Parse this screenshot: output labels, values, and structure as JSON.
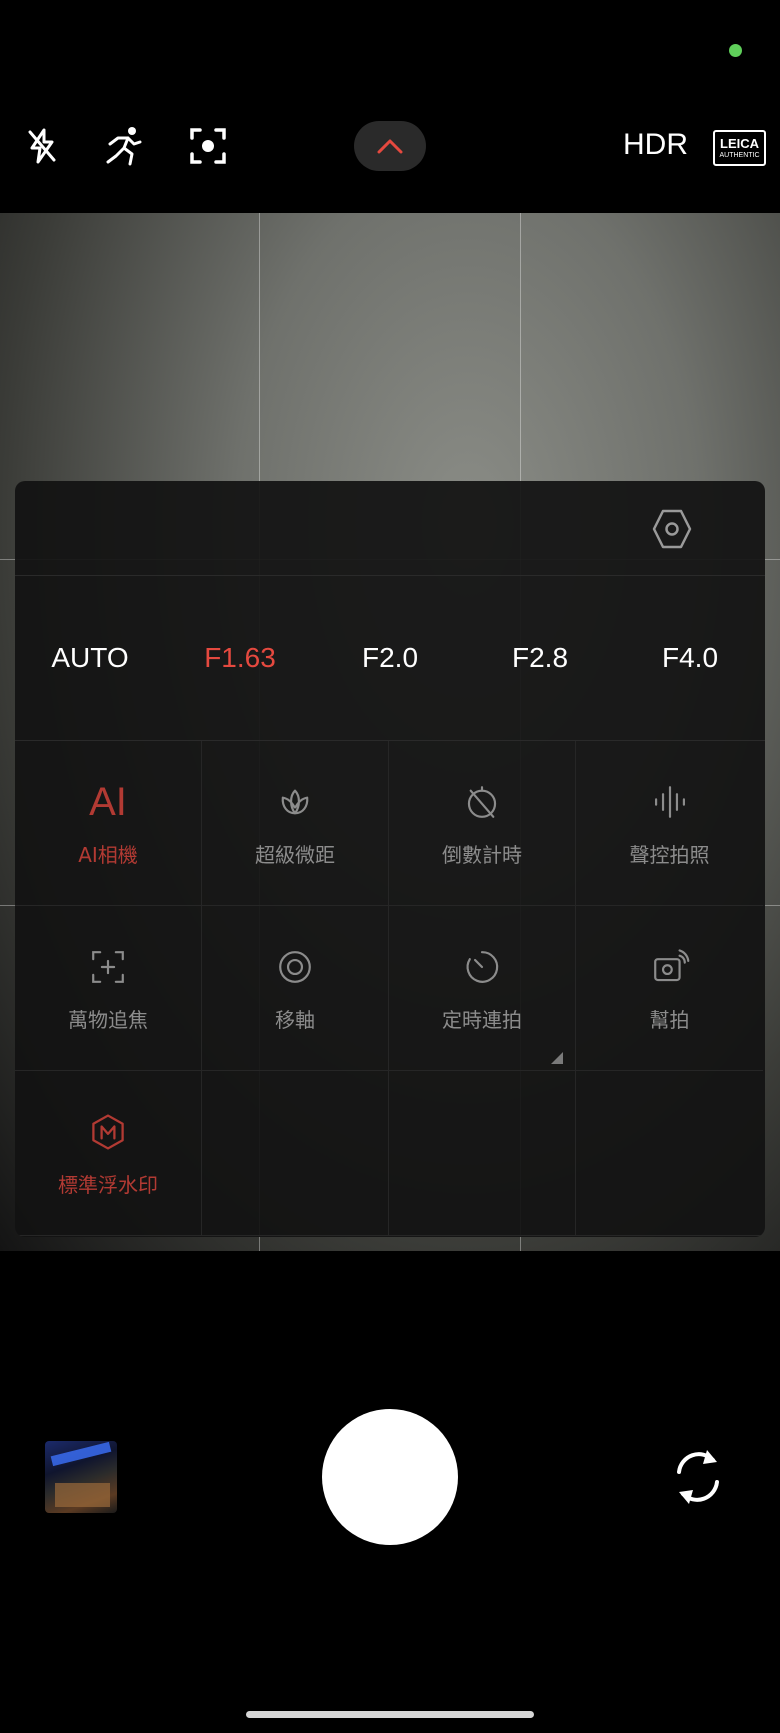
{
  "status": {
    "indicator_color": "#5fcf5a"
  },
  "top_bar": {
    "icons": [
      "flash-off-icon",
      "motion-icon",
      "focus-icon"
    ],
    "expand_icon": "chevron-up-icon",
    "hdr_label": "HDR",
    "leica": {
      "line1": "LEICA",
      "line2": "AUTHENTIC"
    }
  },
  "panel": {
    "settings_icon": "settings-icon",
    "apertures": [
      {
        "label": "AUTO",
        "active": false
      },
      {
        "label": "F1.63",
        "active": true
      },
      {
        "label": "F2.0",
        "active": false
      },
      {
        "label": "F2.8",
        "active": false
      },
      {
        "label": "F4.0",
        "active": false
      }
    ],
    "tiles": [
      {
        "label": "AI相機",
        "icon": "ai-icon",
        "glyph": "AI",
        "active": true
      },
      {
        "label": "超級微距",
        "icon": "macro-icon",
        "active": false
      },
      {
        "label": "倒數計時",
        "icon": "timer-off-icon",
        "active": false
      },
      {
        "label": "聲控拍照",
        "icon": "voice-icon",
        "active": false
      },
      {
        "label": "萬物追焦",
        "icon": "tracking-focus-icon",
        "active": false
      },
      {
        "label": "移軸",
        "icon": "tilt-shift-icon",
        "active": false
      },
      {
        "label": "定時連拍",
        "icon": "interval-shot-icon",
        "active": false
      },
      {
        "label": "幫拍",
        "icon": "assist-shot-icon",
        "active": false
      },
      {
        "label": "標準浮水印",
        "icon": "watermark-icon",
        "active": true
      }
    ]
  },
  "accent_color": "#e5493f",
  "bottom": {
    "gallery_thumbnail": "gallery-thumbnail",
    "shutter": "shutter-button",
    "switch_icon": "switch-camera-icon"
  }
}
